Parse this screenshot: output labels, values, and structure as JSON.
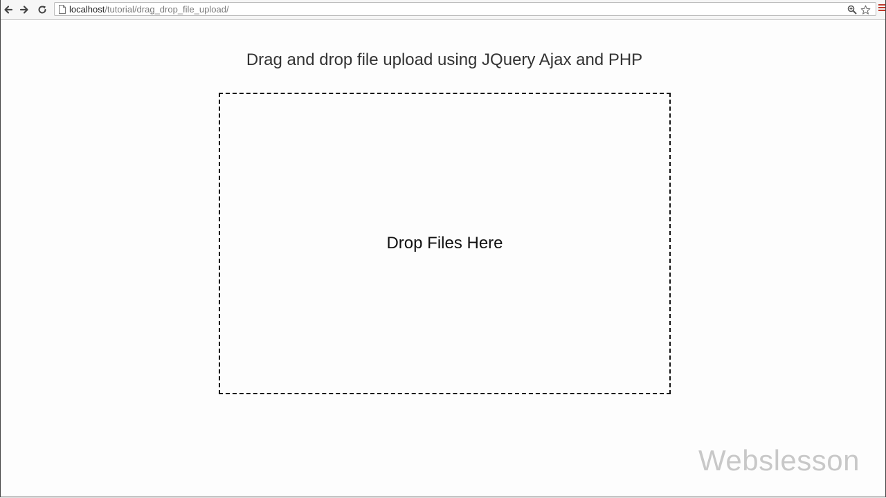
{
  "browser": {
    "url_host": "localhost",
    "url_path": "/tutorial/drag_drop_file_upload/",
    "icons": {
      "back": "back-arrow-icon",
      "forward": "forward-arrow-icon",
      "reload": "reload-icon",
      "page": "page-icon",
      "zoom": "zoom-icon",
      "bookmark": "star-icon",
      "menu": "hamburger-menu-icon"
    }
  },
  "page": {
    "heading": "Drag and drop file upload using JQuery Ajax and PHP",
    "drop_zone_text": "Drop Files Here"
  },
  "watermark": "Webslesson",
  "colors": {
    "drop_border": "#111111",
    "menu_accent": "#c0392b",
    "watermark": "#c8c8c8"
  }
}
